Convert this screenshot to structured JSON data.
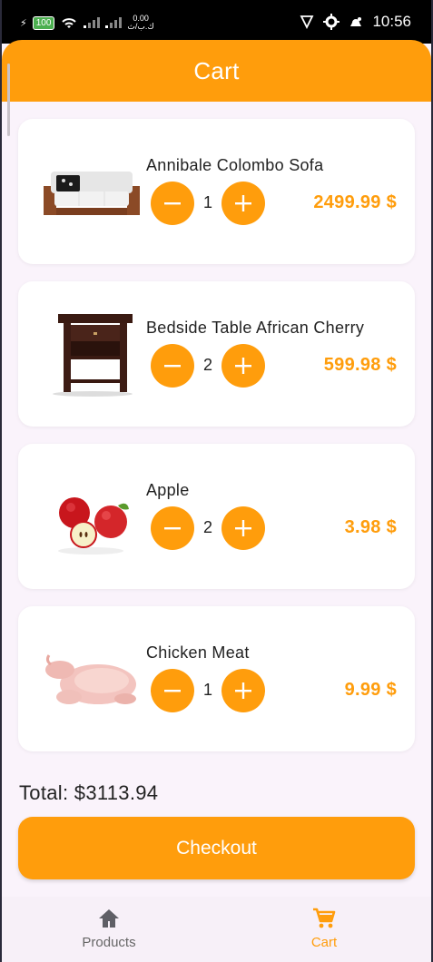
{
  "status_bar": {
    "battery": "100",
    "net_speed_value": "0.00",
    "net_speed_unit": "ك.ب/ث",
    "time": "10:56"
  },
  "app_bar": {
    "title": "Cart"
  },
  "cart": {
    "items": [
      {
        "name": "Annibale Colombo Sofa",
        "quantity": "1",
        "price": "2499.99 $",
        "image_icon": "sofa-image"
      },
      {
        "name": "Bedside Table African Cherry",
        "quantity": "2",
        "price": "599.98 $",
        "image_icon": "bedside-table-image"
      },
      {
        "name": "Apple",
        "quantity": "2",
        "price": "3.98 $",
        "image_icon": "apple-image"
      },
      {
        "name": "Chicken Meat",
        "quantity": "1",
        "price": "9.99 $",
        "image_icon": "chicken-image"
      }
    ],
    "total": "Total: $3113.94",
    "checkout_label": "Checkout"
  },
  "bottom_nav": {
    "items": [
      {
        "label": "Products",
        "icon": "home-icon",
        "active": false
      },
      {
        "label": "Cart",
        "icon": "cart-icon",
        "active": true
      }
    ]
  },
  "colors": {
    "accent": "#ff9d0c",
    "background": "#faf3fb",
    "card": "#ffffff"
  }
}
